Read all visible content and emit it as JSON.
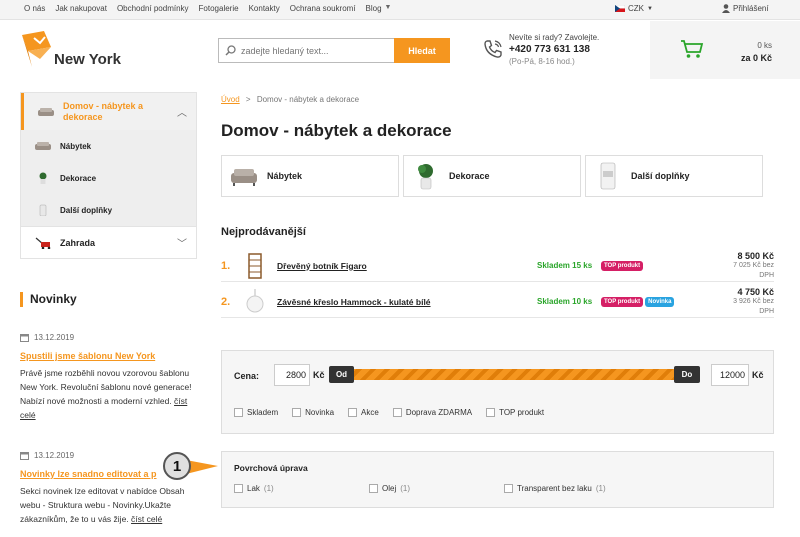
{
  "topbar": {
    "links": [
      "O nás",
      "Jak nakupovat",
      "Obchodní podmínky",
      "Fotogalerie",
      "Kontakty",
      "Ochrana soukromí",
      "Blog"
    ],
    "currency": "CZK",
    "login": "Přihlášení"
  },
  "header": {
    "logo_text": "New York",
    "search_placeholder": "zadejte hledaný text...",
    "search_button": "Hledat",
    "help_question": "Nevíte si rady? Zavolejte.",
    "phone": "+420 773 631 138",
    "hours": "(Po-Pá, 8-16 hod.)",
    "cart_count": "0 ks",
    "cart_total": "za 0 Kč"
  },
  "sidebar": {
    "active": "Domov - nábytek a dekorace",
    "sub": [
      "Nábytek",
      "Dekorace",
      "Další doplňky"
    ],
    "other": "Zahrada"
  },
  "news": {
    "title": "Novinky",
    "items": [
      {
        "date": "13.12.2019",
        "headline": "Spustili jsme šablonu New York",
        "body": "Právě jsme rozběhli novou vzorovou šablonu New York. Revoluční šablonu nové generace! Nabízí nové možnosti a moderní vzhled.",
        "more": "číst celé"
      },
      {
        "date": "13.12.2019",
        "headline": "Novinky lze snadno editovat a p",
        "body": "Sekci novinek lze editovat v nabídce Obsah webu - Struktura webu - Novinky.Ukažte zákazníkům, že to u vás žije.",
        "more": "číst celé"
      }
    ]
  },
  "breadcrumb": {
    "home": "Úvod",
    "sep": ">",
    "current": "Domov - nábytek a dekorace"
  },
  "page_title": "Domov - nábytek a dekorace",
  "categories": [
    "Nábytek",
    "Dekorace",
    "Další doplňky"
  ],
  "bestsellers": {
    "title": "Nejprodávanější",
    "items": [
      {
        "rank": "1.",
        "name": "Dřevěný botník Figaro",
        "stock": "Skladem 15 ks",
        "badges": [
          "TOP produkt"
        ],
        "price": "8 500 Kč",
        "price_ex": "7 025 Kč bez DPH"
      },
      {
        "rank": "2.",
        "name": "Závěsné křeslo Hammock - kulaté bílé",
        "stock": "Skladem 10 ks",
        "badges": [
          "TOP produkt",
          "Novinka"
        ],
        "price": "4 750 Kč",
        "price_ex": "3 926 Kč bez DPH"
      }
    ]
  },
  "filter": {
    "label": "Cena:",
    "min": "2800",
    "max": "12000",
    "unit": "Kč",
    "from": "Od",
    "to": "Do",
    "checks": [
      "Skladem",
      "Novinka",
      "Akce",
      "Doprava ZDARMA",
      "TOP produkt"
    ]
  },
  "surface": {
    "title": "Povrchová úprava",
    "options": [
      {
        "label": "Lak",
        "count": "(1)"
      },
      {
        "label": "Olej",
        "count": "(1)"
      },
      {
        "label": "Transparent bez laku",
        "count": "(1)"
      }
    ]
  },
  "marker": "1",
  "colors": {
    "accent": "#f5961f",
    "top_badge": "#d51f65",
    "new_badge": "#29a3e0",
    "stock": "#2aa52a"
  }
}
